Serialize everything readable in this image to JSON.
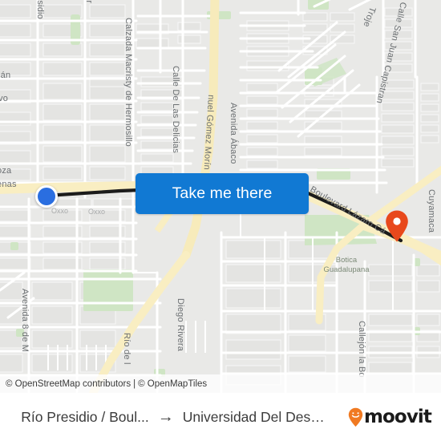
{
  "map": {
    "type": "street-map",
    "provider_attribution": {
      "osm": "© OpenStreetMap contributors",
      "separator": "|",
      "tiles": "© OpenMapTiles"
    },
    "origin_marker_name": "origin-dot",
    "destination_marker_name": "destination-pin",
    "colors": {
      "origin_dot": "#2a6ee0",
      "destination_pin": "#e8481c",
      "primary_road": "#f7e9b8",
      "route_line": "#1c1c1c",
      "land": "#e9e9e7",
      "building": "#e3e3e1",
      "park": "#cfe5c4",
      "water": "#aad3df",
      "accent_button": "#1179d3"
    },
    "street_labels": [
      {
        "text": "esidio",
        "note": "Río Presidio (clipped)"
      },
      {
        "text": "ur",
        "note": "Sur (clipped)"
      },
      {
        "text": "ján",
        "note": "clipped"
      },
      {
        "text": "vo",
        "note": "clipped"
      },
      {
        "text": "oza",
        "note": "clipped"
      },
      {
        "text": "enas",
        "note": "Cárdenas (clipped)"
      },
      {
        "text": "Calzada Macristy de Hermosillo"
      },
      {
        "text": "Calle De Las Delicias"
      },
      {
        "text": "nuel Gómez Morín"
      },
      {
        "text": "Avenida Ábaco"
      },
      {
        "text": "Troje"
      },
      {
        "text": "Calle San Juan Capistran"
      },
      {
        "text": "Boulevard Lázaro Cárdenas"
      },
      {
        "text": "Cuyamaca"
      },
      {
        "text": "Avenida 8 de M"
      },
      {
        "text": "Río de l"
      },
      {
        "text": "Diego Rivera"
      },
      {
        "text": "Callejón la Bo"
      },
      {
        "text": "Cal"
      }
    ],
    "poi_labels": [
      {
        "text": "Botica",
        "text2": "Guadalupana",
        "kind": "pharmacy"
      },
      {
        "text": "Oxxo",
        "kind": "convenience"
      },
      {
        "text": "Oxxo",
        "kind": "convenience"
      }
    ]
  },
  "cta": {
    "label": "Take me there"
  },
  "footer": {
    "origin": "Río Presidio / Boul...",
    "arrow": "→",
    "destination": "Universidad Del Desarrollo P...",
    "brand": "moovit"
  }
}
